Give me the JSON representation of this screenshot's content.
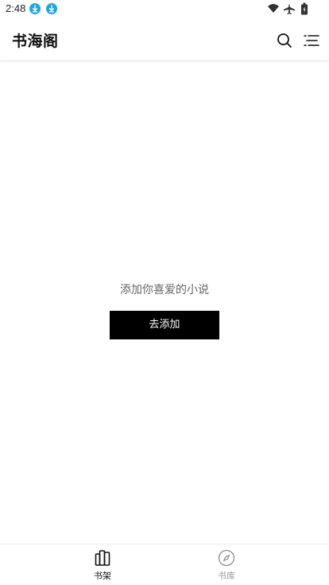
{
  "status_bar": {
    "time": "2:48",
    "download_color": "#1aa6e8"
  },
  "header": {
    "title": "书海阁",
    "search_icon": "search-icon",
    "menu_icon": "menu-icon"
  },
  "empty_state": {
    "message": "添加你喜爱的小说",
    "add_button_label": "去添加"
  },
  "tabbar": {
    "tabs": [
      {
        "label": "书架",
        "icon": "bookshelf-icon",
        "active": true
      },
      {
        "label": "书库",
        "icon": "compass-icon",
        "active": false
      }
    ],
    "active_color": "#111111",
    "inactive_color": "#9a9a9a"
  }
}
